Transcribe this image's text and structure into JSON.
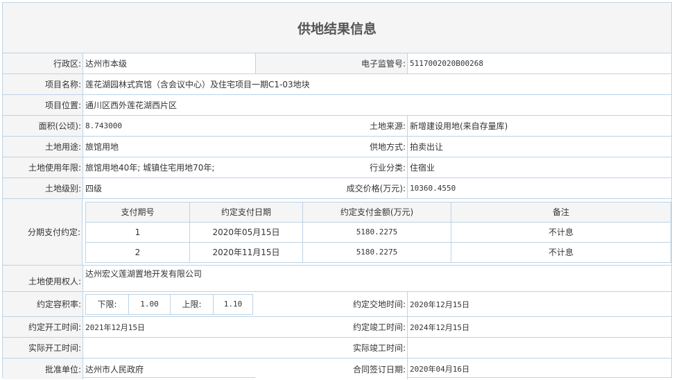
{
  "title": "供地结果信息",
  "fields": {
    "region_label": "行政区:",
    "region": "达州市本级",
    "supervision_label": "电子监管号:",
    "supervision": "5117002020B00268",
    "project_name_label": "项目名称:",
    "project_name": "莲花湖园林式宾馆（含会议中心）及住宅项目一期C1-03地块",
    "location_label": "项目位置:",
    "location": "通川区西外莲花湖西片区",
    "area_label": "面积(公顷):",
    "area": "8.743000",
    "source_label": "土地来源:",
    "source": "新增建设用地(来自存量库)",
    "usage_label": "土地用途:",
    "usage": "旅馆用地",
    "supply_method_label": "供地方式:",
    "supply_method": "拍卖出让",
    "term_label": "土地使用年限:",
    "term": "旅馆用地40年; 城镇住宅用地70年;",
    "industry_label": "行业分类:",
    "industry": "住宿业",
    "grade_label": "土地级别:",
    "grade": "四级",
    "price_label": "成交价格(万元):",
    "price": "10360.4550",
    "installment_label": "分期支付约定:",
    "owner_label": "土地使用权人:",
    "owner": "达州宏义莲湖置地开发有限公司",
    "plot_ratio_label": "约定容积率:",
    "lower_label": "下限:",
    "lower": "1.00",
    "upper_label": "上限:",
    "upper": "1.10",
    "delivery_label": "约定交地时间:",
    "delivery": "2020年12月15日",
    "start_label": "约定开工时间:",
    "start": "2021年12月15日",
    "finish_label": "约定竣工时间:",
    "finish": "2024年12月15日",
    "actual_start_label": "实际开工时间:",
    "actual_start": "",
    "actual_finish_label": "实际竣工时间:",
    "actual_finish": "",
    "approval_label": "批准单位:",
    "approval": "达州市人民政府",
    "contract_date_label": "合同签订日期:",
    "contract_date": "2020年04月16日"
  },
  "payments": {
    "headers": [
      "支付期号",
      "约定支付日期",
      "约定支付金额(万元)",
      "备注"
    ],
    "rows": [
      [
        "1",
        "2020年05月15日",
        "5180.2275",
        "不计息"
      ],
      [
        "2",
        "2020年11月15日",
        "5180.2275",
        "不计息"
      ]
    ]
  }
}
